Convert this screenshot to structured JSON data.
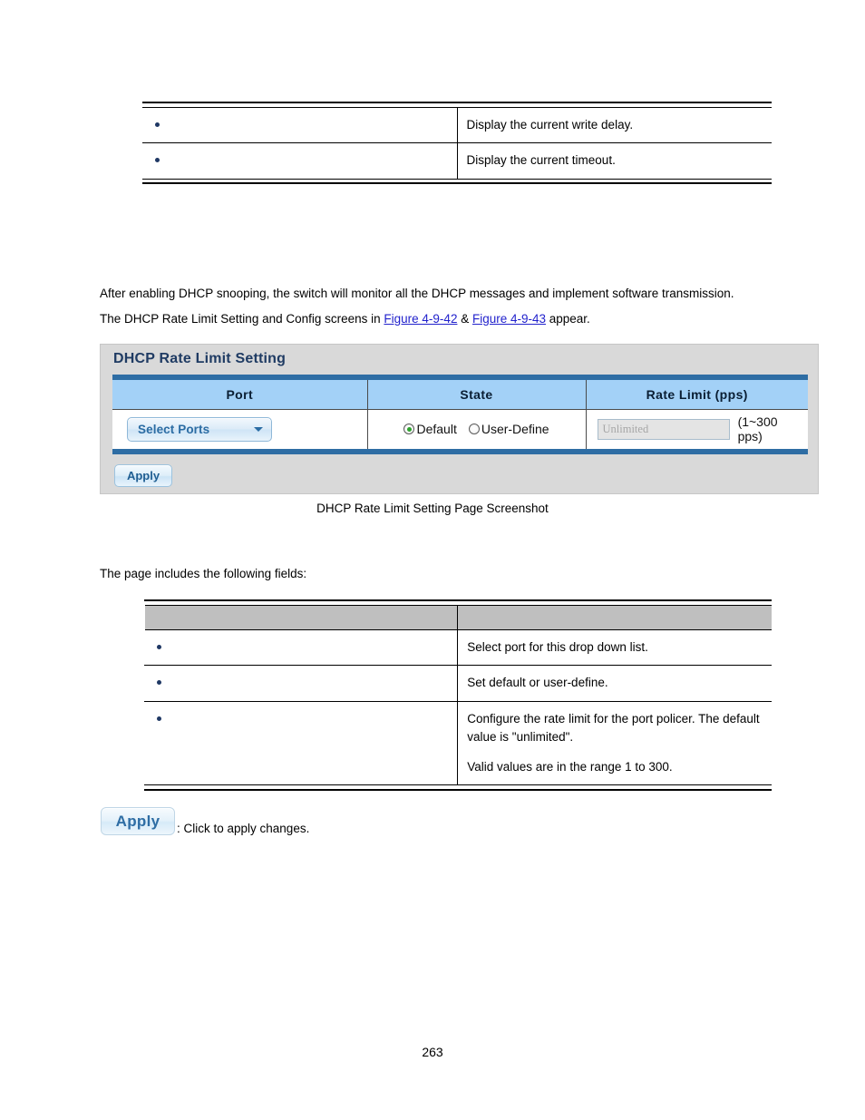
{
  "top_table": {
    "rows": [
      {
        "bullet": "•",
        "description": "Display the current write delay."
      },
      {
        "bullet": "•",
        "description": "Display the current timeout."
      }
    ]
  },
  "intro": {
    "paragraph_1": "After enabling DHCP snooping, the switch will monitor all the DHCP messages and implement software transmission.",
    "paragraph_2_before": "The DHCP Rate Limit Setting and Config screens in ",
    "figure_link_1": "Figure 4-9-42",
    "paragraph_2_middle": " & ",
    "figure_link_2": "Figure 4-9-43",
    "paragraph_2_after": " appear.",
    "link_color": "#2222CC"
  },
  "panel": {
    "title": "DHCP Rate Limit Setting",
    "headers": [
      "Port",
      "State",
      "Rate Limit (pps)"
    ],
    "port": {
      "dropdown_label": "Select Ports",
      "caret_icon": "chevron-down-icon"
    },
    "state": {
      "options": [
        {
          "label": "Default",
          "selected": true
        },
        {
          "label": "User-Define",
          "selected": false
        }
      ],
      "selected_color": "#2DA32D"
    },
    "rate_limit": {
      "input_placeholder": "Unlimited",
      "input_value": "",
      "hint": "(1~300 pps)",
      "disabled": true
    },
    "apply_label": "Apply",
    "header_bg": "#A3D1F7",
    "band_color": "#2E6DA4",
    "panel_bg": "#D9D9D9",
    "title_color": "#1F3B63"
  },
  "caption": "DHCP Rate Limit Setting Page Screenshot",
  "fields_intro": "The page includes the following fields:",
  "fields_table": {
    "header": [
      "",
      ""
    ],
    "header_bg": "#BFBFBF",
    "rows": [
      {
        "bullet": "•",
        "lines": [
          "Select port for this drop down list."
        ]
      },
      {
        "bullet": "•",
        "lines": [
          "Set default or user-define."
        ]
      },
      {
        "bullet": "•",
        "lines": [
          "Configure the rate limit for the port policer. The default value is \"unlimited\".",
          "Valid values are in the range 1 to 300."
        ]
      }
    ]
  },
  "legend": {
    "apply_label": "Apply",
    "apply_description": ": Click to apply changes."
  },
  "page_number": "263"
}
